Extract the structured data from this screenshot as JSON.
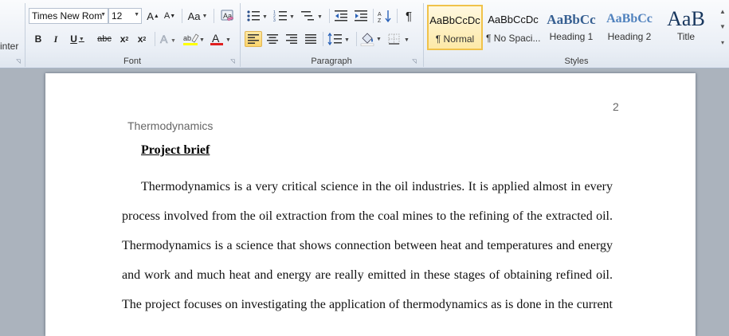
{
  "clipboard": {
    "partial_label": "inter"
  },
  "font": {
    "group_label": "Font",
    "font_name": "Times New Rom",
    "font_size": "12",
    "grow": "A",
    "shrink": "A",
    "change_case": "Aa",
    "bold": "B",
    "italic": "I",
    "underline": "U",
    "strikethrough": "abc",
    "subscript": "x",
    "superscript": "x",
    "highlight_color": "#ffff00",
    "font_color": "#e02020"
  },
  "paragraph": {
    "group_label": "Paragraph",
    "alignment": "left",
    "pilcrow": "¶"
  },
  "styles": {
    "group_label": "Styles",
    "items": [
      {
        "sample": "AaBbCcDc",
        "name": "¶ Normal",
        "selected": true
      },
      {
        "sample": "AaBbCcDc",
        "name": "¶ No Spaci..."
      },
      {
        "sample": "AaBbCc",
        "name": "Heading 1"
      },
      {
        "sample": "AaBbCc",
        "name": "Heading 2"
      },
      {
        "sample": "AaB",
        "name": "Title"
      }
    ]
  },
  "document": {
    "page_number": "2",
    "running_head": "Thermodynamics",
    "heading": "Project brief",
    "lines": [
      "Thermodynamics is a very critical science in the oil industries. It is applied almost in every",
      "process involved from the oil extraction from the coal mines to the refining of the extracted oil.",
      "Thermodynamics is a science that shows connection between heat and temperatures and energy",
      "and work and much heat and energy are really emitted in these stages of obtaining refined oil.",
      "The project focuses on investigating the application of thermodynamics as is done in the current"
    ]
  }
}
